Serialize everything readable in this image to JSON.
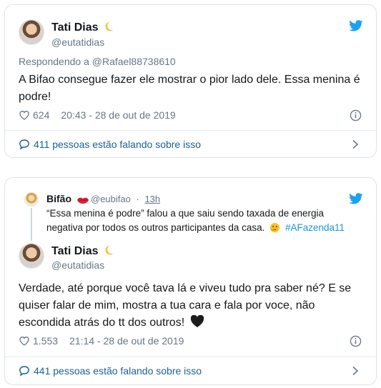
{
  "colors": {
    "twitter_blue": "#1da1f2",
    "link": "#1b95e0",
    "muted": "#657786",
    "text": "#14171a"
  },
  "tweet1": {
    "author_name": "Tati Dias",
    "author_handle": "@eutatidias",
    "name_emoji": "crescent-moon-icon",
    "reply_to": "Respondendo a @Rafael88738610",
    "text": "A Bifao consegue fazer ele mostrar o pior lado dele. Essa menina é podre!",
    "likes": "624",
    "timestamp": "20:43 - 28 de out de 2019",
    "talking": "411 pessoas estão falando sobre isso"
  },
  "tweet2": {
    "quoted": {
      "author_name": "Bifão",
      "name_emoji": "lips-icon",
      "author_handle": "@eubifao",
      "dot": "·",
      "age": "13h",
      "text_before_emoji": "“Essa menina é podre” falou a que saiu sendo taxada de energia negativa por todos os outros participantes da casa.",
      "emoji": "thinking-face-icon",
      "hashtag": "#AFazenda11"
    },
    "author_name": "Tati Dias",
    "author_handle": "@eutatidias",
    "name_emoji": "crescent-moon-icon",
    "text": "Verdade, até porque você tava lá e viveu tudo pra saber né? E se quiser falar de mim, mostra a tua cara e fala por voce, não escondida atrás do tt dos outros!",
    "text_emoji": "black-heart-icon",
    "likes": "1.553",
    "timestamp": "21:14 - 28 de out de 2019",
    "talking": "441 pessoas estão falando sobre isso"
  }
}
